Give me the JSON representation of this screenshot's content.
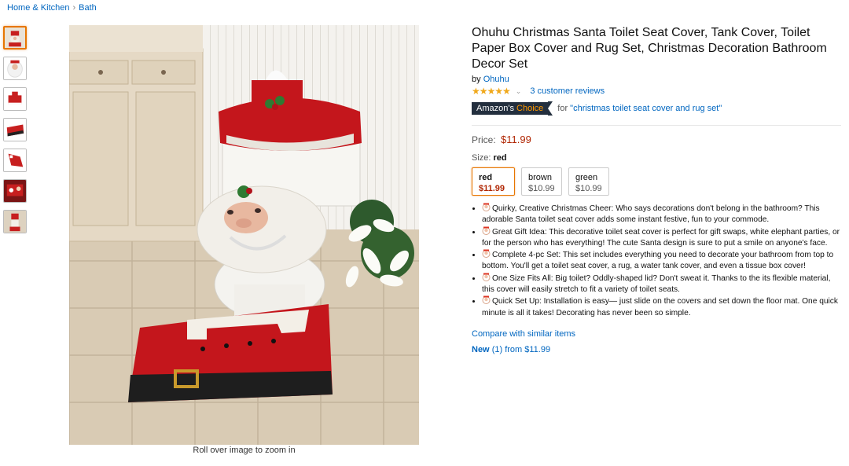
{
  "breadcrumb": {
    "items": [
      "Home & Kitchen",
      "Bath"
    ],
    "separator": "›"
  },
  "gallery": {
    "thumbnail_count": 7,
    "zoom_hint": "Roll over image to zoom in"
  },
  "product": {
    "title": "Ohuhu Christmas Santa Toilet Seat Cover, Tank Cover, Toilet Paper Box Cover and Rug Set, Christmas Decoration Bathroom Decor Set",
    "by_label": "by",
    "brand": "Ohuhu",
    "stars": "★★★★★",
    "star_rating": 4.5,
    "review_count_text": "3 customer reviews",
    "choice": {
      "amazons": "Amazon's",
      "choice": "Choice",
      "for_label": "for",
      "keyword": "\"christmas toilet seat cover and rug set\""
    },
    "price_label": "Price:",
    "price": "$11.99",
    "size_label": "Size:",
    "size_selected": "red",
    "options": [
      {
        "name": "red",
        "price": "$11.99"
      },
      {
        "name": "brown",
        "price": "$10.99"
      },
      {
        "name": "green",
        "price": "$10.99"
      }
    ],
    "bullets": [
      "Quirky, Creative Christmas Cheer: Who says decorations don't belong in the bathroom? This adorable Santa toilet seat cover adds some instant festive, fun to your commode.",
      "Great Gift Idea: This decorative toilet seat cover is perfect for gift swaps, white elephant parties, or for the person who has everything! The cute Santa design is sure to put a smile on anyone's face.",
      "Complete 4-pc Set: This set includes everything you need to decorate your bathroom from top to bottom. You'll get a toilet seat cover, a rug, a water tank cover, and even a tissue box cover!",
      "One Size Fits All: Big toilet? Oddly-shaped lid? Don't sweat it. Thanks to the its flexible material, this cover will easily stretch to fit a variety of toilet seats.",
      "Quick Set Up: Installation is easy— just slide on the covers and set down the floor mat. One quick minute is all it takes! Decorating has never been so simple."
    ],
    "compare_link": "Compare with similar items",
    "offers": {
      "new_label": "New",
      "count_text": "(1) from",
      "from_price": "$11.99"
    }
  },
  "colors": {
    "link": "#0066c0",
    "price": "#b12704",
    "star": "#f0a81a",
    "choice_bg": "#232f3e",
    "choice_accent": "#ff9900",
    "selected_border": "#e77600"
  },
  "icons": {
    "bullet_icon": "santa-face-icon",
    "rating_caret": "chevron-down-icon"
  }
}
